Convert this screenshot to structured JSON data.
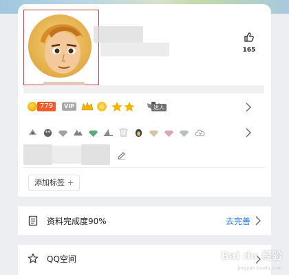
{
  "profile": {
    "like_count": "165"
  },
  "badges": {
    "level_value": "779",
    "vip_label": "VIP",
    "talent_label": "达人"
  },
  "tags": {
    "add_label": "添加标签",
    "plus": "+"
  },
  "completion": {
    "label": "资料完成度90%",
    "action": "去完善"
  },
  "qq_space": {
    "label": "QQ空间"
  },
  "watermark": {
    "text": "Bai du 经验",
    "sub": "jingyan.baidu.com"
  },
  "colors": {
    "accent_blue": "#2b7fe0",
    "level_orange": "#f35a2a",
    "highlight_red": "#d23a3a"
  }
}
